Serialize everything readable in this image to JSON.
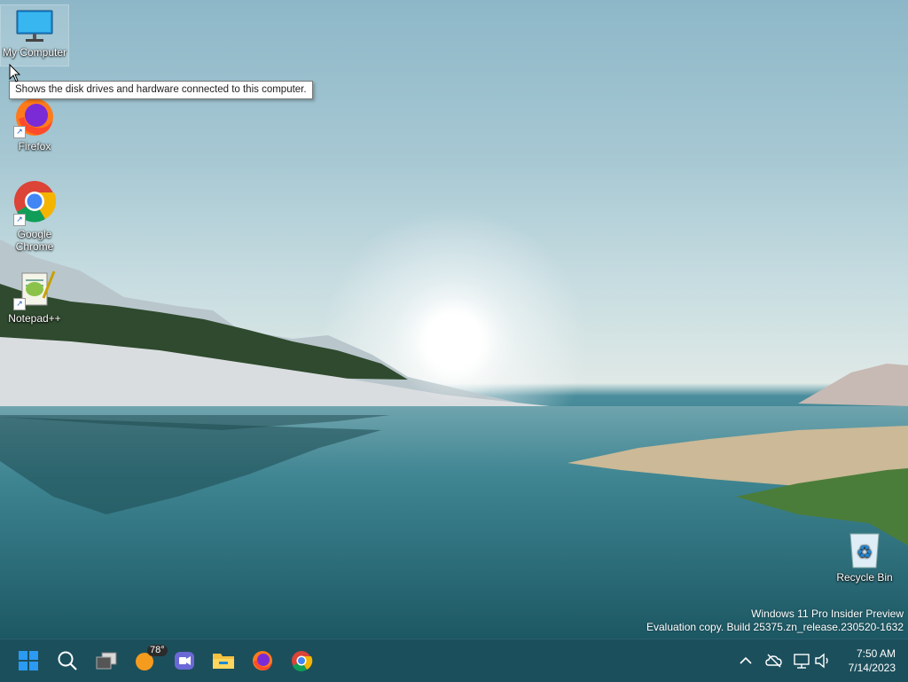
{
  "desktop": {
    "icons": [
      {
        "label": "My Computer",
        "icon": "monitor-icon",
        "shortcut": false
      },
      {
        "label": "Firefox",
        "icon": "firefox-icon",
        "shortcut": true
      },
      {
        "label": "Google Chrome",
        "icon": "chrome-icon",
        "shortcut": true
      },
      {
        "label": "Notepad++",
        "icon": "notepadpp-icon",
        "shortcut": true
      },
      {
        "label": "Recycle Bin",
        "icon": "recycle-bin-icon",
        "shortcut": false
      }
    ],
    "tooltip": "Shows the disk drives and hardware connected to this computer."
  },
  "watermark": {
    "line1": "Windows 11 Pro Insider Preview",
    "line2": "Evaluation copy. Build 25375.zn_release.230520-1632"
  },
  "taskbar": {
    "weather_temp": "78°",
    "apps": [
      "start-icon",
      "search-icon",
      "task-view-icon",
      "weather-icon",
      "chat-icon",
      "file-explorer-icon",
      "firefox-icon",
      "chrome-icon"
    ],
    "tray_icons": [
      "chevron-up-icon",
      "onedrive-offline-icon",
      "network-icon",
      "volume-icon"
    ],
    "time": "7:50 AM",
    "date": "7/14/2023"
  },
  "colors": {
    "taskbar": "#1c4f5c",
    "start_blue": "#2b9af3"
  }
}
